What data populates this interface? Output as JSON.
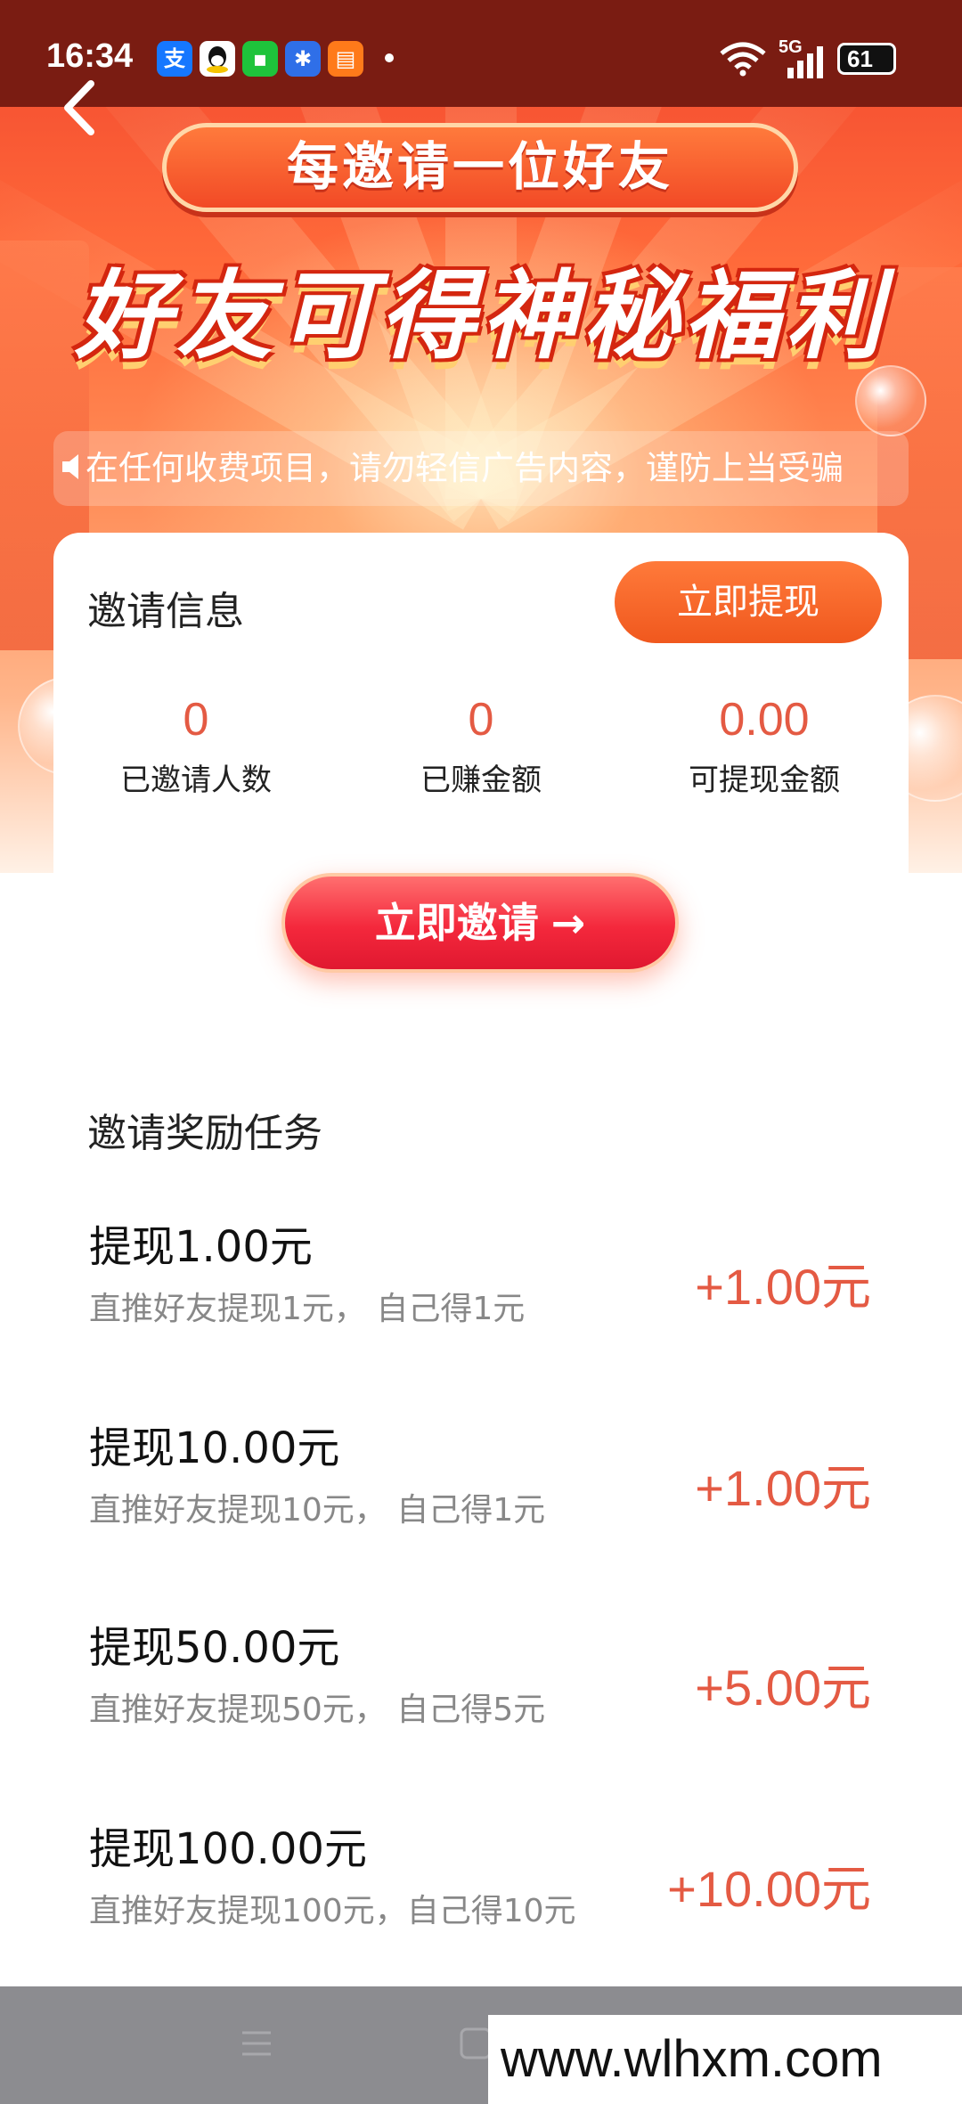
{
  "status_bar": {
    "time": "16:34",
    "app_icons": [
      {
        "name": "alipay-icon",
        "glyph": "支",
        "color": "#1677ff"
      },
      {
        "name": "qq-icon",
        "glyph": "●",
        "color": "#111111"
      },
      {
        "name": "green-app-icon",
        "glyph": "▪",
        "color": "#1ec33b"
      },
      {
        "name": "blue-app-icon",
        "glyph": "✱",
        "color": "#2f6fe8"
      },
      {
        "name": "books-app-icon",
        "glyph": "▤",
        "color": "#ff7a1a"
      }
    ],
    "network": "5G",
    "battery": "61"
  },
  "banner": {
    "subtitle": "每邀请一位好友",
    "title": "好友可得神秘福利"
  },
  "notice": {
    "text": "在任何收费项目，请勿轻信广告内容，谨防上当受骗"
  },
  "invite_info": {
    "title": "邀请信息",
    "withdraw_label": "立即提现",
    "stats": [
      {
        "value": "0",
        "label": "已邀请人数"
      },
      {
        "value": "0",
        "label": "已赚金额"
      },
      {
        "value": "0.00",
        "label": "可提现金额"
      }
    ]
  },
  "invite_button": {
    "label": "立即邀请",
    "arrow": "→"
  },
  "tasks": {
    "title": "邀请奖励任务",
    "items": [
      {
        "title": "提现1.00元",
        "desc": "直推好友提现1元， 自己得1元",
        "reward": "+1.00元"
      },
      {
        "title": "提现10.00元",
        "desc": "直推好友提现10元， 自己得1元",
        "reward": "+1.00元"
      },
      {
        "title": "提现50.00元",
        "desc": "直推好友提现50元， 自己得5元",
        "reward": "+5.00元"
      },
      {
        "title": "提现100.00元",
        "desc": "直推好友提现100元，自己得10元",
        "reward": "+10.00元"
      }
    ]
  },
  "watermark": "www.wlhxm.com",
  "colors": {
    "accent": "#e45a43",
    "button_orange": "#f0581e",
    "status_bar": "#7a1c12"
  }
}
